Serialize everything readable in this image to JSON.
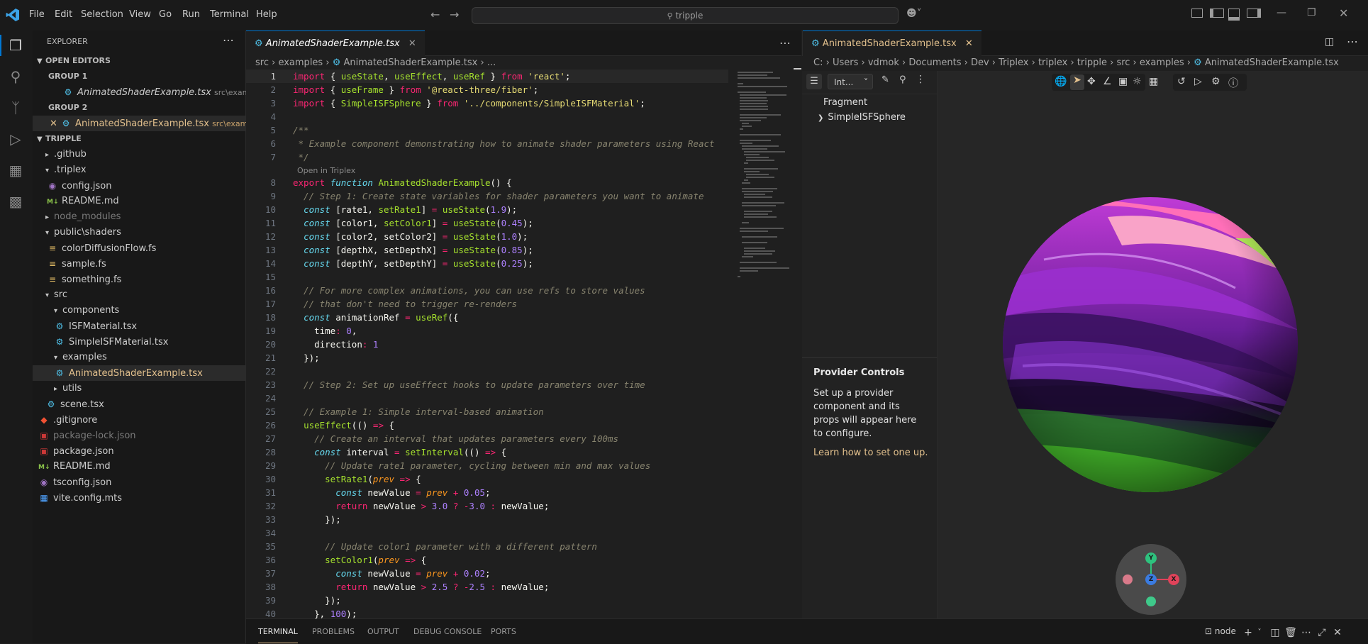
{
  "titlebar": {
    "menu": [
      "File",
      "Edit",
      "Selection",
      "View",
      "Go",
      "Run",
      "Terminal",
      "Help"
    ],
    "search_text": "tripple",
    "window_controls": [
      "minimize-icon",
      "restore-icon",
      "close-icon"
    ]
  },
  "activity_bar": {
    "icons": [
      "files-icon",
      "search-icon",
      "source-control-icon",
      "run-debug-icon",
      "extensions-icon",
      "remote-icon"
    ]
  },
  "explorer": {
    "title": "EXPLORER",
    "open_editors_label": "OPEN EDITORS",
    "group1_label": "GROUP 1",
    "group1_file": "AnimatedShaderExample.tsx",
    "group1_path": "src\\examples",
    "group2_label": "GROUP 2",
    "group2_file": "AnimatedShaderExample.tsx",
    "group2_path": "src\\exampl...",
    "project_label": "TRIPPLE",
    "tree": [
      {
        "label": ".github",
        "kind": "folder"
      },
      {
        "label": ".triplex",
        "kind": "folder-open"
      },
      {
        "label": "config.json",
        "kind": "json"
      },
      {
        "label": "README.md",
        "kind": "md"
      },
      {
        "label": "node_modules",
        "kind": "folder-dim"
      },
      {
        "label": "public\\shaders",
        "kind": "folder-open"
      },
      {
        "label": "colorDiffusionFlow.fs",
        "kind": "fs"
      },
      {
        "label": "sample.fs",
        "kind": "fs"
      },
      {
        "label": "something.fs",
        "kind": "fs"
      },
      {
        "label": "src",
        "kind": "folder-open"
      },
      {
        "label": "components",
        "kind": "folder-open"
      },
      {
        "label": "ISFMaterial.tsx",
        "kind": "tsx"
      },
      {
        "label": "SimpleISFMaterial.tsx",
        "kind": "tsx"
      },
      {
        "label": "examples",
        "kind": "folder-open"
      },
      {
        "label": "AnimatedShaderExample.tsx",
        "kind": "tsx-sel"
      },
      {
        "label": "utils",
        "kind": "folder"
      },
      {
        "label": "scene.tsx",
        "kind": "tsx"
      },
      {
        "label": ".gitignore",
        "kind": "git"
      },
      {
        "label": "package-lock.json",
        "kind": "json-dim"
      },
      {
        "label": "package.json",
        "kind": "pkg"
      },
      {
        "label": "README.md",
        "kind": "md"
      },
      {
        "label": "tsconfig.json",
        "kind": "json"
      },
      {
        "label": "vite.config.mts",
        "kind": "vite"
      }
    ]
  },
  "editor": {
    "tab_label": "AnimatedShaderExample.tsx",
    "breadcrumb": [
      "src",
      "examples",
      "AnimatedShaderExample.tsx",
      "..."
    ],
    "codelens": "Open in Triplex",
    "lines": [
      {
        "n": "1",
        "text": "import { useState, useEffect, useRef } from 'react';"
      },
      {
        "n": "2",
        "text": "import { useFrame } from '@react-three/fiber';"
      },
      {
        "n": "3",
        "text": "import { SimpleISFSphere } from '../components/SimpleISFMaterial';"
      },
      {
        "n": "4",
        "text": ""
      },
      {
        "n": "5",
        "text": "/**"
      },
      {
        "n": "6",
        "text": " * Example component demonstrating how to animate shader parameters using React"
      },
      {
        "n": "7",
        "text": " */"
      },
      {
        "n": "8",
        "text": "export function AnimatedShaderExample() {"
      },
      {
        "n": "9",
        "text": "  // Step 1: Create state variables for shader parameters you want to animate"
      },
      {
        "n": "10",
        "text": "  const [rate1, setRate1] = useState(1.9);"
      },
      {
        "n": "11",
        "text": "  const [color1, setColor1] = useState(0.45);"
      },
      {
        "n": "12",
        "text": "  const [color2, setColor2] = useState(1.0);"
      },
      {
        "n": "13",
        "text": "  const [depthX, setDepthX] = useState(0.85);"
      },
      {
        "n": "14",
        "text": "  const [depthY, setDepthY] = useState(0.25);"
      },
      {
        "n": "15",
        "text": ""
      },
      {
        "n": "16",
        "text": "  // For more complex animations, you can use refs to store values"
      },
      {
        "n": "17",
        "text": "  // that don't need to trigger re-renders"
      },
      {
        "n": "18",
        "text": "  const animationRef = useRef({"
      },
      {
        "n": "19",
        "text": "    time: 0,"
      },
      {
        "n": "20",
        "text": "    direction: 1"
      },
      {
        "n": "21",
        "text": "  });"
      },
      {
        "n": "22",
        "text": ""
      },
      {
        "n": "23",
        "text": "  // Step 2: Set up useEffect hooks to update parameters over time"
      },
      {
        "n": "24",
        "text": ""
      },
      {
        "n": "25",
        "text": "  // Example 1: Simple interval-based animation"
      },
      {
        "n": "26",
        "text": "  useEffect(() => {"
      },
      {
        "n": "27",
        "text": "    // Create an interval that updates parameters every 100ms"
      },
      {
        "n": "28",
        "text": "    const interval = setInterval(() => {"
      },
      {
        "n": "29",
        "text": "      // Update rate1 parameter, cycling between min and max values"
      },
      {
        "n": "30",
        "text": "      setRate1(prev => {"
      },
      {
        "n": "31",
        "text": "        const newValue = prev + 0.05;"
      },
      {
        "n": "32",
        "text": "        return newValue > 3.0 ? -3.0 : newValue;"
      },
      {
        "n": "33",
        "text": "      });"
      },
      {
        "n": "34",
        "text": ""
      },
      {
        "n": "35",
        "text": "      // Update color1 parameter with a different pattern"
      },
      {
        "n": "36",
        "text": "      setColor1(prev => {"
      },
      {
        "n": "37",
        "text": "        const newValue = prev + 0.02;"
      },
      {
        "n": "38",
        "text": "        return newValue > 2.5 ? -2.5 : newValue;"
      },
      {
        "n": "39",
        "text": "      });"
      },
      {
        "n": "40",
        "text": "    }, 100);"
      }
    ]
  },
  "triplex": {
    "tab_label": "AnimatedShaderExample.tsx",
    "breadcrumb": [
      "C:",
      "Users",
      "vdmok",
      "Documents",
      "Dev",
      "Triplex",
      "triplex",
      "tripple",
      "src",
      "examples",
      "AnimatedShaderExample.tsx"
    ],
    "filter_value": "Int...",
    "scene_tree_header": "Fragment",
    "scene_tree_item": "SimpleISFSphere",
    "provider_title": "Provider Controls",
    "provider_text": "Set up a provider component and its props will appear here to configure.",
    "provider_link": "Learn how to set one up.",
    "gizmo": {
      "y": "Y",
      "x": "X",
      "z": "Z"
    }
  },
  "bottom_panel": {
    "tabs": [
      "TERMINAL",
      "PROBLEMS",
      "OUTPUT",
      "DEBUG CONSOLE",
      "PORTS"
    ],
    "active_tab": "TERMINAL",
    "terminal_name": "node"
  },
  "colors": {
    "accent": "#0078d4",
    "tab_active_text": "#e2c08d",
    "keyword": "#f92672",
    "string": "#e6db74",
    "function": "#a6e22e",
    "comment": "#88846f",
    "number": "#ae81ff"
  }
}
